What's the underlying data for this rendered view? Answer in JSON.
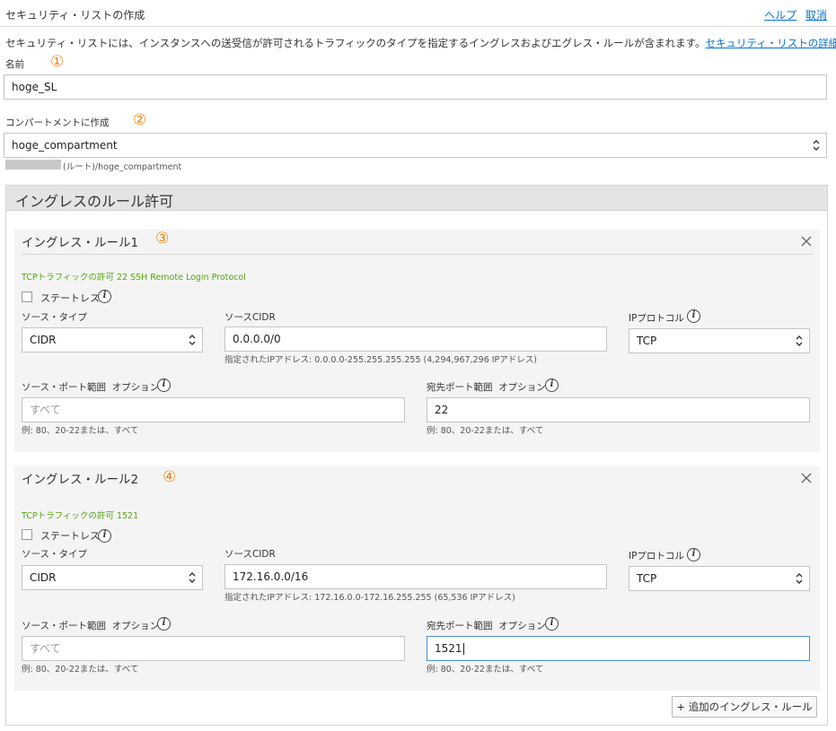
{
  "header": {
    "title": "セキュリティ・リストの作成",
    "help_label": "ヘルプ",
    "cancel_label": "取消"
  },
  "description": {
    "text": "セキュリティ・リストには、インスタンスへの送受信が許可されるトラフィックのタイプを指定するイングレスおよびエグレス・ルールが含まれます。",
    "link": "セキュリティ・リストの詳細"
  },
  "markers": [
    "①",
    "②",
    "③",
    "④"
  ],
  "name_field": {
    "label": "名前",
    "value": "hoge_SL"
  },
  "compartment_field": {
    "label": "コンパートメントに作成",
    "value": "hoge_compartment",
    "path": "(ルート)/hoge_compartment"
  },
  "ingress": {
    "section_title": "イングレスのルール許可",
    "add_button": "+ 追加のイングレス・ルール",
    "rules": [
      {
        "title": "イングレス・ルール1",
        "summary": "TCPトラフィックの許可 22 SSH Remote Login Protocol",
        "stateless_label": "ステートレス",
        "source_type_label": "ソース・タイプ",
        "source_type_value": "CIDR",
        "source_cidr_label": "ソースCIDR",
        "source_cidr_value": "0.0.0.0/0",
        "source_cidr_hint": "指定されたIPアドレス: 0.0.0.0-255.255.255.255 (4,294,967,296 IPアドレス)",
        "ip_protocol_label": "IPプロトコル",
        "ip_protocol_value": "TCP",
        "source_port_label": "ソース・ポート範囲",
        "optional_label": "オプション",
        "source_port_placeholder": "すべて",
        "source_port_hint": "例: 80、20-22または、すべて",
        "dest_port_label": "宛先ポート範囲",
        "dest_port_value": "22",
        "dest_port_hint": "例: 80、20-22または、すべて"
      },
      {
        "title": "イングレス・ルール2",
        "summary": "TCPトラフィックの許可 1521",
        "stateless_label": "ステートレス",
        "source_type_label": "ソース・タイプ",
        "source_type_value": "CIDR",
        "source_cidr_label": "ソースCIDR",
        "source_cidr_value": "172.16.0.0/16",
        "source_cidr_hint": "指定されたIPアドレス: 172.16.0.0-172.16.255.255 (65,536 IPアドレス)",
        "ip_protocol_label": "IPプロトコル",
        "ip_protocol_value": "TCP",
        "source_port_label": "ソース・ポート範囲",
        "optional_label": "オプション",
        "source_port_placeholder": "すべて",
        "source_port_hint": "例: 80、20-22または、すべて",
        "dest_port_label": "宛先ポート範囲",
        "dest_port_value": "1521",
        "dest_port_hint": "例: 80、20-22または、すべて"
      }
    ]
  },
  "colors": {
    "link": "#0572ce",
    "summary_green": "#56a60f",
    "marker_orange": "#f0820f",
    "section_header_bg": "#e4e4e4",
    "rule_bg": "#f4f4f4",
    "focus_border": "#4a8fd0"
  },
  "icons": {
    "info": "info-circle-icon",
    "close": "close-icon",
    "select_arrows": "chevron-up-down-icon"
  }
}
